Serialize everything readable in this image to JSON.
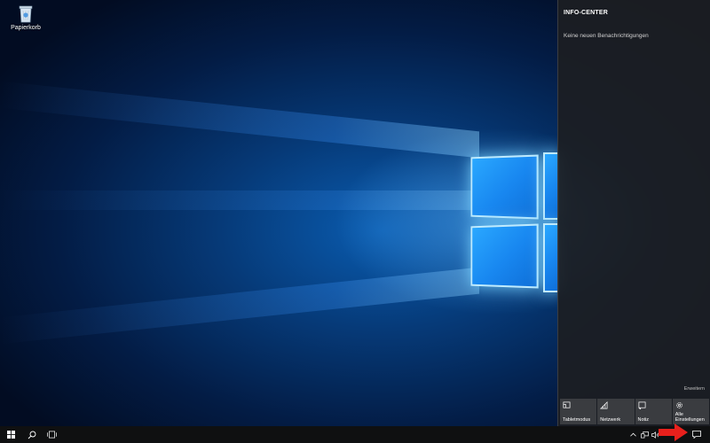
{
  "desktop": {
    "icons": [
      {
        "label": "Papierkorb",
        "icon": "recycle-bin-icon"
      }
    ]
  },
  "action_center": {
    "title": "INFO-CENTER",
    "empty_message": "Keine neuen Benachrichtigungen",
    "expand_label": "Erweitern",
    "quick_actions": [
      {
        "label": "Tabletmodus",
        "icon": "tablet-mode-icon"
      },
      {
        "label": "Netzwerk",
        "icon": "network-icon"
      },
      {
        "label": "Notiz",
        "icon": "note-icon"
      },
      {
        "label": "Alle Einstellungen",
        "icon": "gear-icon"
      }
    ]
  },
  "taskbar": {
    "start_icon": "windows-logo-icon",
    "search_icon": "search-icon",
    "task_view_icon": "task-view-icon",
    "tray": [
      "chevron-up-icon",
      "network-tray-icon",
      "volume-icon",
      "notification-icon"
    ]
  },
  "annotation": {
    "color": "#e8201c",
    "shape": "arrow-right"
  },
  "colors": {
    "accent": "#1e8ef5",
    "panel_bg": "#1c1e22",
    "tile_bg": "#3a3c40",
    "taskbar_bg": "#0f1011"
  }
}
